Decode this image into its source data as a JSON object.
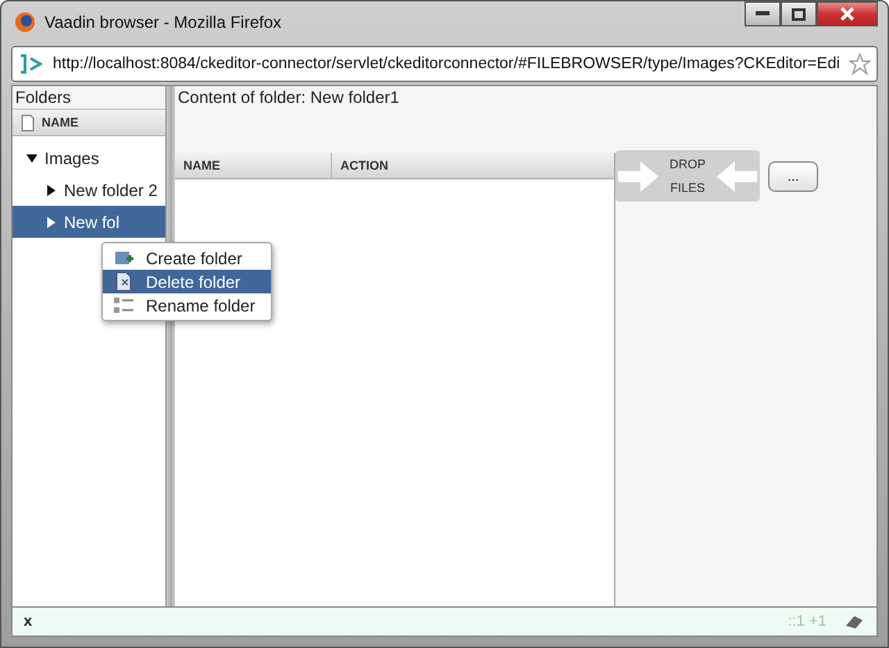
{
  "window": {
    "title": "Vaadin browser - Mozilla Firefox"
  },
  "url": "http://localhost:8084/ckeditor-connector/servlet/ckeditorconnector/#FILEBROWSER/type/Images?CKEditor=Edi",
  "folders_panel": {
    "caption": "Folders",
    "column": "NAME",
    "tree": [
      {
        "label": "Images",
        "expanded": true,
        "selected": false,
        "children": [
          {
            "label": "New folder 2",
            "expanded": false,
            "selected": false
          },
          {
            "label": "New fol",
            "expanded": false,
            "selected": true
          }
        ]
      }
    ]
  },
  "content_panel": {
    "caption": "Content of folder: New folder1",
    "columns": [
      "NAME",
      "ACTION"
    ],
    "drop_zone": [
      "DROP",
      "FILES"
    ],
    "browse_button": "..."
  },
  "context_menu": [
    {
      "label": "Create folder",
      "selected": false,
      "kind": "create"
    },
    {
      "label": "Delete folder",
      "selected": true,
      "kind": "delete"
    },
    {
      "label": "Rename folder",
      "selected": false,
      "kind": "rename"
    }
  ],
  "status_bar": {
    "close": "x",
    "indicator": "::1 +1"
  }
}
